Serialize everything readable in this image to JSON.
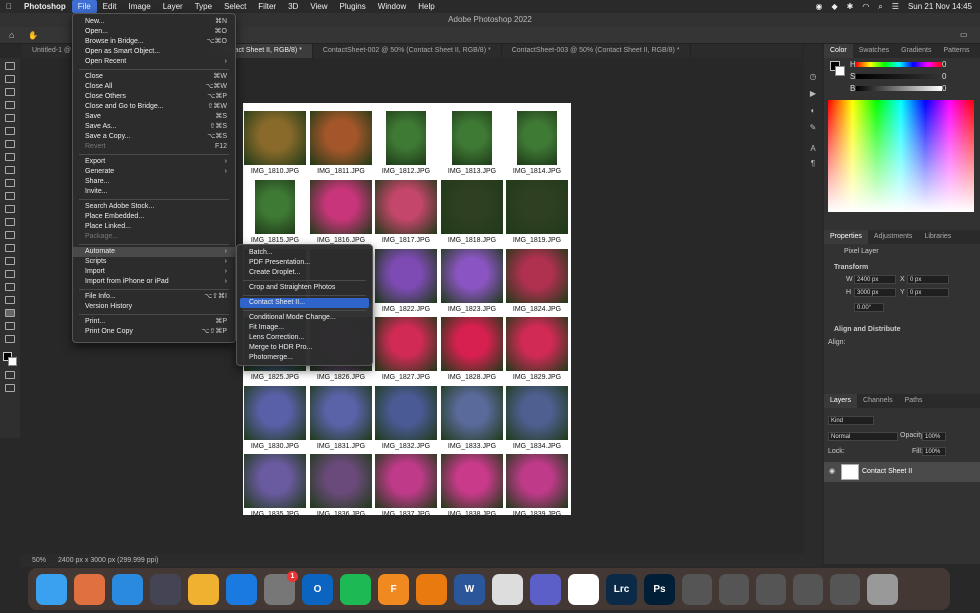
{
  "menubar": {
    "app": "Photoshop",
    "items": [
      "File",
      "Edit",
      "Image",
      "Layer",
      "Type",
      "Select",
      "Filter",
      "3D",
      "View",
      "Plugins",
      "Window",
      "Help"
    ],
    "datetime": "Sun 21 Nov  14:45"
  },
  "window_title": "Adobe Photoshop 2022",
  "tabs": [
    "Untitled-1 @ ...",
    "Contact Sheet II, RGB/8) *",
    "ContactSheet-002 @ 50% (Contact Sheet II, RGB/8) *",
    "ContactSheet-003 @ 50% (Contact Sheet II, RGB/8) *"
  ],
  "file_menu": [
    {
      "label": "New...",
      "shortcut": "⌘N"
    },
    {
      "label": "Open...",
      "shortcut": "⌘O"
    },
    {
      "label": "Browse in Bridge...",
      "shortcut": "⌥⌘O"
    },
    {
      "label": "Open as Smart Object...",
      "shortcut": ""
    },
    {
      "label": "Open Recent",
      "shortcut": "›"
    },
    {
      "sep": true
    },
    {
      "label": "Close",
      "shortcut": "⌘W"
    },
    {
      "label": "Close All",
      "shortcut": "⌥⌘W"
    },
    {
      "label": "Close Others",
      "shortcut": "⌥⌘P"
    },
    {
      "label": "Close and Go to Bridge...",
      "shortcut": "⇧⌘W"
    },
    {
      "label": "Save",
      "shortcut": "⌘S"
    },
    {
      "label": "Save As...",
      "shortcut": "⇧⌘S"
    },
    {
      "label": "Save a Copy...",
      "shortcut": "⌥⌘S"
    },
    {
      "label": "Revert",
      "shortcut": "F12",
      "disabled": true
    },
    {
      "sep": true
    },
    {
      "label": "Export",
      "shortcut": "›"
    },
    {
      "label": "Generate",
      "shortcut": "›"
    },
    {
      "label": "Share...",
      "shortcut": ""
    },
    {
      "label": "Invite...",
      "shortcut": ""
    },
    {
      "sep": true
    },
    {
      "label": "Search Adobe Stock...",
      "shortcut": ""
    },
    {
      "label": "Place Embedded...",
      "shortcut": ""
    },
    {
      "label": "Place Linked...",
      "shortcut": ""
    },
    {
      "label": "Package...",
      "shortcut": "",
      "disabled": true
    },
    {
      "sep": true
    },
    {
      "label": "Automate",
      "shortcut": "›",
      "highlight": true
    },
    {
      "label": "Scripts",
      "shortcut": "›"
    },
    {
      "label": "Import",
      "shortcut": "›"
    },
    {
      "label": "Import from iPhone or iPad",
      "shortcut": "›"
    },
    {
      "sep": true
    },
    {
      "label": "File Info...",
      "shortcut": "⌥⇧⌘I"
    },
    {
      "label": "Version History",
      "shortcut": ""
    },
    {
      "sep": true
    },
    {
      "label": "Print...",
      "shortcut": "⌘P"
    },
    {
      "label": "Print One Copy",
      "shortcut": "⌥⇧⌘P"
    }
  ],
  "automate_menu": [
    {
      "label": "Batch..."
    },
    {
      "label": "PDF Presentation..."
    },
    {
      "label": "Create Droplet..."
    },
    {
      "sep": true
    },
    {
      "label": "Crop and Straighten Photos"
    },
    {
      "sep": true
    },
    {
      "label": "Contact Sheet II...",
      "selected": true
    },
    {
      "sep": true
    },
    {
      "label": "Conditional Mode Change..."
    },
    {
      "label": "Fit Image..."
    },
    {
      "label": "Lens Correction..."
    },
    {
      "label": "Merge to HDR Pro..."
    },
    {
      "label": "Photomerge..."
    }
  ],
  "thumbnails": [
    [
      "IMG_1810.JPG",
      "IMG_1811.JPG",
      "IMG_1812.JPG",
      "IMG_1813.JPG",
      "IMG_1814.JPG"
    ],
    [
      "IMG_1815.JPG",
      "IMG_1816.JPG",
      "IMG_1817.JPG",
      "IMG_1818.JPG",
      "IMG_1819.JPG"
    ],
    [
      "",
      "",
      "IMG_1822.JPG",
      "IMG_1823.JPG",
      "IMG_1824.JPG"
    ],
    [
      "IMG_1825.JPG",
      "IMG_1826.JPG",
      "IMG_1827.JPG",
      "IMG_1828.JPG",
      "IMG_1829.JPG"
    ],
    [
      "IMG_1830.JPG",
      "IMG_1831.JPG",
      "IMG_1832.JPG",
      "IMG_1833.JPG",
      "IMG_1834.JPG"
    ],
    [
      "IMG_1835.JPG",
      "IMG_1836.JPG",
      "IMG_1837.JPG",
      "IMG_1838.JPG",
      "IMG_1839.JPG"
    ]
  ],
  "thumb_colors": [
    [
      "#8a6a2a",
      "#a4562a",
      "#3f7a35",
      "#3f7a35",
      "#3f7a35"
    ],
    [
      "#3f7a35",
      "#c9357a",
      "#c4466a",
      "#2f3f22",
      "#2f3f22"
    ],
    [
      "#333",
      "#333",
      "#7e4bb5",
      "#8a55c2",
      "#b03050"
    ],
    [
      "#4a5a90",
      "#7a4a8a",
      "#d02a55",
      "#d82050",
      "#d02a55"
    ],
    [
      "#5a60a8",
      "#5a62a8",
      "#4a5a95",
      "#5a6a9a",
      "#4e5f90"
    ],
    [
      "#6a5aa0",
      "#6a4a7a",
      "#c03a8a",
      "#c93a8a",
      "#c03a8a"
    ]
  ],
  "thumb_portrait": [
    [
      false,
      false,
      true,
      true,
      true
    ],
    [
      true,
      false,
      false,
      false,
      false
    ],
    [
      false,
      false,
      false,
      false,
      false
    ],
    [
      false,
      false,
      false,
      false,
      false
    ],
    [
      false,
      false,
      false,
      false,
      false
    ],
    [
      false,
      false,
      false,
      false,
      false
    ]
  ],
  "status": {
    "zoom": "50%",
    "info": "2400 px x 3000 px (299.999 ppi)"
  },
  "color_panel": {
    "tabs": [
      "Color",
      "Swatches",
      "Gradients",
      "Patterns"
    ],
    "channels": [
      "H",
      "S",
      "B"
    ],
    "values": [
      "0",
      "0",
      "0"
    ]
  },
  "properties_panel": {
    "tabs": [
      "Properties",
      "Adjustments",
      "Libraries"
    ],
    "layer_type": "Pixel Layer",
    "transform_label": "Transform",
    "w": "2400 px",
    "h": "3000 px",
    "x": "0 px",
    "y": "0 px",
    "angle": "0.00°",
    "align_label": "Align and Distribute",
    "align_sub": "Align:"
  },
  "layers_panel": {
    "tabs": [
      "Layers",
      "Channels",
      "Paths"
    ],
    "kind": "Kind",
    "blend": "Normal",
    "opacity_label": "Opacity:",
    "opacity": "100%",
    "lock_label": "Lock:",
    "fill_label": "Fill:",
    "fill": "100%",
    "layer_name": "Contact Sheet II"
  },
  "dock": [
    "Finder",
    "Launchpad",
    "Safari",
    "Preview",
    "Photos",
    "App Store",
    "System Preferences",
    "Outlook",
    "Spotify",
    "Fusion 360",
    "Blender",
    "Word",
    "Pen",
    "Teams",
    "Chrome",
    "Lrc",
    "Ps"
  ],
  "dock_colors": [
    "#3aa0f0",
    "#e07040",
    "#2a8ae0",
    "#445",
    "#f0b030",
    "#1a7ae0",
    "#777",
    "#0a64c0",
    "#1db954",
    "#f08a20",
    "#e87a10",
    "#2b579a",
    "#ddd",
    "#5b5fc7",
    "#fff",
    "#0b2a48",
    "#001e36"
  ],
  "dock_labels": [
    "",
    "",
    "",
    "",
    "",
    "",
    "",
    "O",
    "",
    "F",
    "",
    "W",
    "",
    "",
    "",
    "Lrc",
    "Ps"
  ],
  "dock_badge": "1"
}
